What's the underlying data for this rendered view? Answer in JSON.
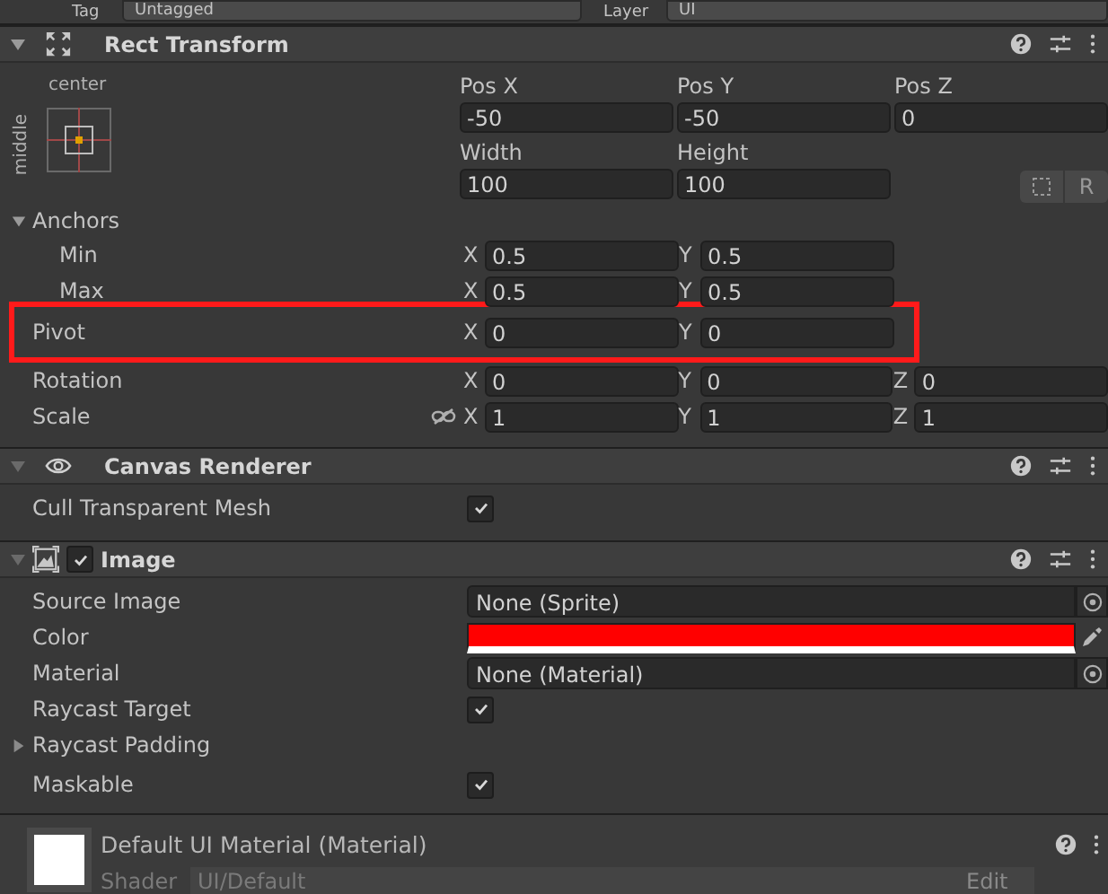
{
  "top_bar": {
    "tag_label": "Tag",
    "tag_value": "Untagged",
    "layer_label": "Layer",
    "layer_value": "UI"
  },
  "rect_transform": {
    "title": "Rect Transform",
    "expanded": true,
    "anchor_preset": {
      "horizontal": "center",
      "vertical": "middle"
    },
    "fields": [
      {
        "label": "Pos X",
        "value": "-50"
      },
      {
        "label": "Pos Y",
        "value": "-50"
      },
      {
        "label": "Pos Z",
        "value": "0"
      },
      {
        "label": "Width",
        "value": "100"
      },
      {
        "label": "Height",
        "value": "100"
      }
    ],
    "raw_button": "R",
    "anchors": {
      "label": "Anchors",
      "expanded": true,
      "children": [
        {
          "label": "Min",
          "values": [
            {
              "axis": "X",
              "value": "0.5"
            },
            {
              "axis": "Y",
              "value": "0.5"
            }
          ]
        },
        {
          "label": "Max",
          "values": [
            {
              "axis": "X",
              "value": "0.5"
            },
            {
              "axis": "Y",
              "value": "0.5"
            }
          ]
        }
      ]
    },
    "vectors": [
      {
        "label": "Pivot",
        "highlighted": true,
        "constrain_icon": false,
        "values": [
          {
            "axis": "X",
            "value": "0"
          },
          {
            "axis": "Y",
            "value": "0"
          }
        ]
      },
      {
        "label": "Rotation",
        "highlighted": false,
        "constrain_icon": false,
        "values": [
          {
            "axis": "X",
            "value": "0"
          },
          {
            "axis": "Y",
            "value": "0"
          },
          {
            "axis": "Z",
            "value": "0"
          }
        ]
      },
      {
        "label": "Scale",
        "highlighted": false,
        "constrain_icon": true,
        "values": [
          {
            "axis": "X",
            "value": "1"
          },
          {
            "axis": "Y",
            "value": "1"
          },
          {
            "axis": "Z",
            "value": "1"
          }
        ]
      }
    ]
  },
  "canvas_renderer": {
    "title": "Canvas Renderer",
    "expanded": true,
    "properties": [
      {
        "kind": "checkbox",
        "label": "Cull Transparent Mesh",
        "checked": true
      }
    ]
  },
  "image": {
    "title": "Image",
    "expanded": true,
    "enabled": true,
    "properties": [
      {
        "kind": "object",
        "label": "Source Image",
        "value": "None (Sprite)"
      },
      {
        "kind": "color",
        "label": "Color",
        "color": "#ff0000"
      },
      {
        "kind": "object",
        "label": "Material",
        "value": "None (Material)"
      },
      {
        "kind": "checkbox",
        "label": "Raycast Target",
        "checked": true
      },
      {
        "kind": "foldout",
        "label": "Raycast Padding",
        "expanded": false
      },
      {
        "kind": "checkbox",
        "label": "Maskable",
        "checked": true
      }
    ]
  },
  "material": {
    "name": "Default UI Material (Material)",
    "shader_label": "Shader",
    "shader": "UI/Default",
    "edit_button": "Edit"
  }
}
